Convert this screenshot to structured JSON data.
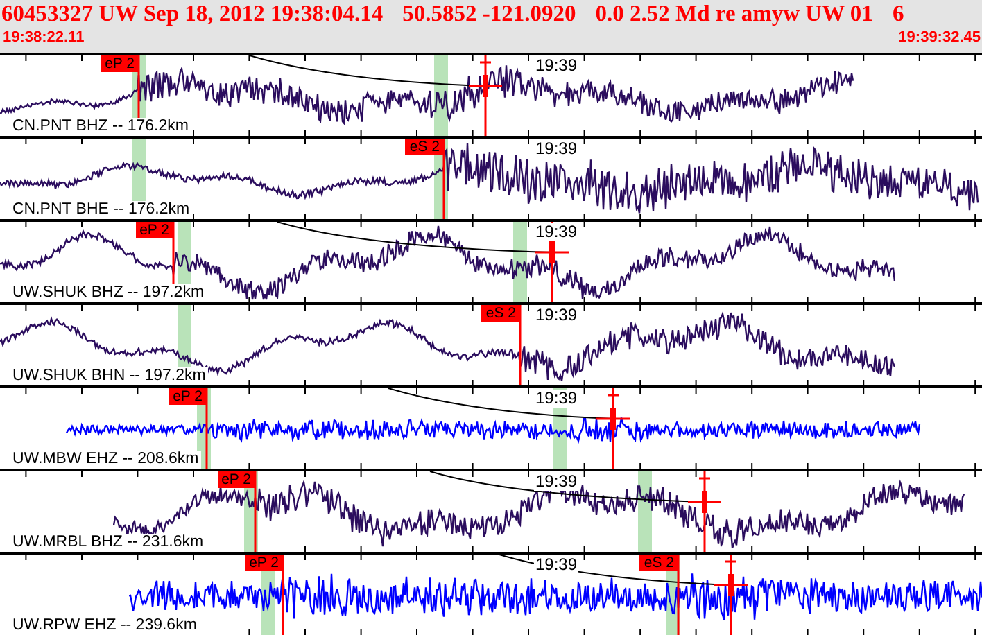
{
  "header": {
    "title_parts": [
      "60453327 UW Sep 18, 2012 19:38:04.14",
      "50.5852 -121.0920",
      "0.0 2.52 Md re amyw UW 01",
      "6"
    ],
    "start_time": "19:38:22.11",
    "end_time": "19:39:32.45"
  },
  "traces": [
    {
      "station": "CN.PNT BHZ -- 176.2km",
      "color": "#2b0d5e",
      "time_label": "19:39",
      "picks": [
        {
          "label": "eP 2"
        }
      ]
    },
    {
      "station": "CN.PNT BHE -- 176.2km",
      "color": "#2b0d5e",
      "time_label": "19:39",
      "picks": [
        {
          "label": "eS 2"
        }
      ]
    },
    {
      "station": "UW.SHUK BHZ -- 197.2km",
      "color": "#2b0d5e",
      "time_label": "19:39",
      "picks": [
        {
          "label": "eP 2"
        }
      ]
    },
    {
      "station": "UW.SHUK BHN -- 197.2km",
      "color": "#2b0d5e",
      "time_label": "19:39",
      "picks": [
        {
          "label": "eS 2"
        }
      ]
    },
    {
      "station": "UW.MBW EHZ -- 208.6km",
      "color": "#0000ff",
      "time_label": "19:39",
      "picks": [
        {
          "label": "eP 2"
        }
      ]
    },
    {
      "station": "UW.MRBL BHZ -- 231.6km",
      "color": "#2b0d5e",
      "time_label": "19:39",
      "picks": [
        {
          "label": "eP 2"
        }
      ]
    },
    {
      "station": "UW.RPW EHZ -- 239.6km",
      "color": "#0000ff",
      "time_label": "19:39",
      "picks": [
        {
          "label": "eP 2"
        },
        {
          "label": "eS 2"
        }
      ]
    }
  ]
}
